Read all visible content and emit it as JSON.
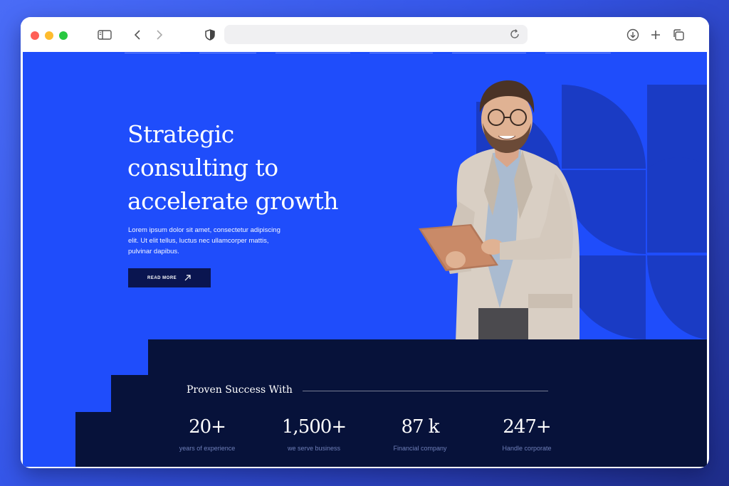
{
  "hero": {
    "title_line1": "Strategic",
    "title_line2": "consulting to",
    "title_line3": "accelerate growth",
    "description": "Lorem ipsum dolor sit amet, consectetur adipiscing elit. Ut elit tellus, luctus nec ullamcorper mattis, pulvinar dapibus.",
    "button_label": "READ MORE"
  },
  "stats": {
    "title": "Proven Success With",
    "items": [
      {
        "value": "20+",
        "label": "years of experience"
      },
      {
        "value": "1,500+",
        "label": "we serve business"
      },
      {
        "value": "87 k",
        "label": "Financial company"
      },
      {
        "value": "247+",
        "label": "Handle corporate"
      }
    ]
  },
  "colors": {
    "hero_bg": "#1f4dfb",
    "dark_navy": "#0a1550",
    "shape_blue": "#1a3bc4",
    "stats_bg": "#07123a"
  },
  "icons": {
    "sidebar": "sidebar-icon",
    "back": "chevron-left-icon",
    "forward": "chevron-right-icon",
    "privacy": "shield-icon",
    "reload": "reload-icon",
    "download": "download-icon",
    "new_tab": "plus-icon",
    "tabs": "tabs-icon",
    "button_arrow": "arrow-up-right-icon"
  }
}
